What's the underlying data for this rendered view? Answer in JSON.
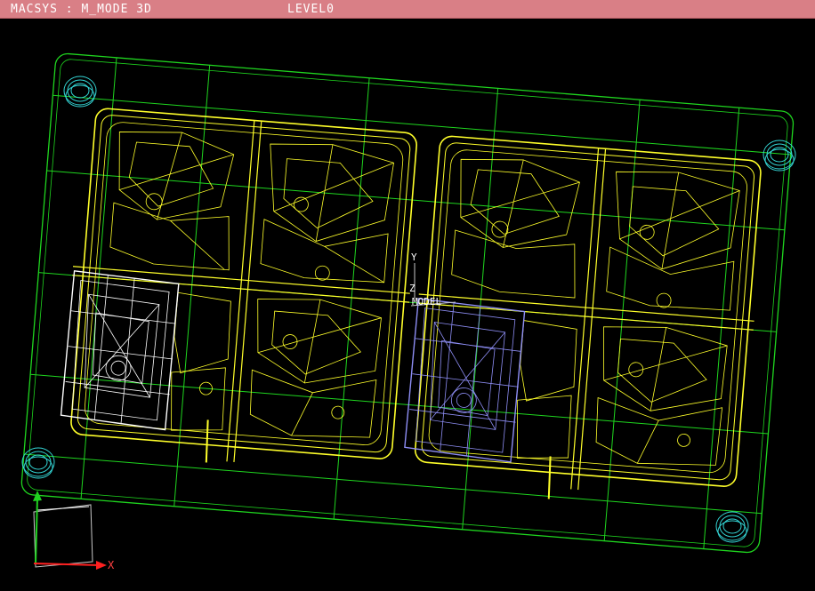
{
  "titlebar": {
    "app": "MACSYS : M_MODE 3D",
    "level": "LEVEL0"
  },
  "view": {
    "triad_y": "Y",
    "triad_z": "Z",
    "triad_label": "MODEL",
    "axis_x": "X",
    "colors": {
      "background": "#000000",
      "grid": "#1fd61f",
      "part": "#ffff2a",
      "selected_white": "#ffffff",
      "selected_blue": "#8e8ef5",
      "holes": "#34d6d6",
      "axis_x": "#ff2020",
      "axis_y": "#20d020",
      "frame": "#c8c8c8"
    }
  }
}
